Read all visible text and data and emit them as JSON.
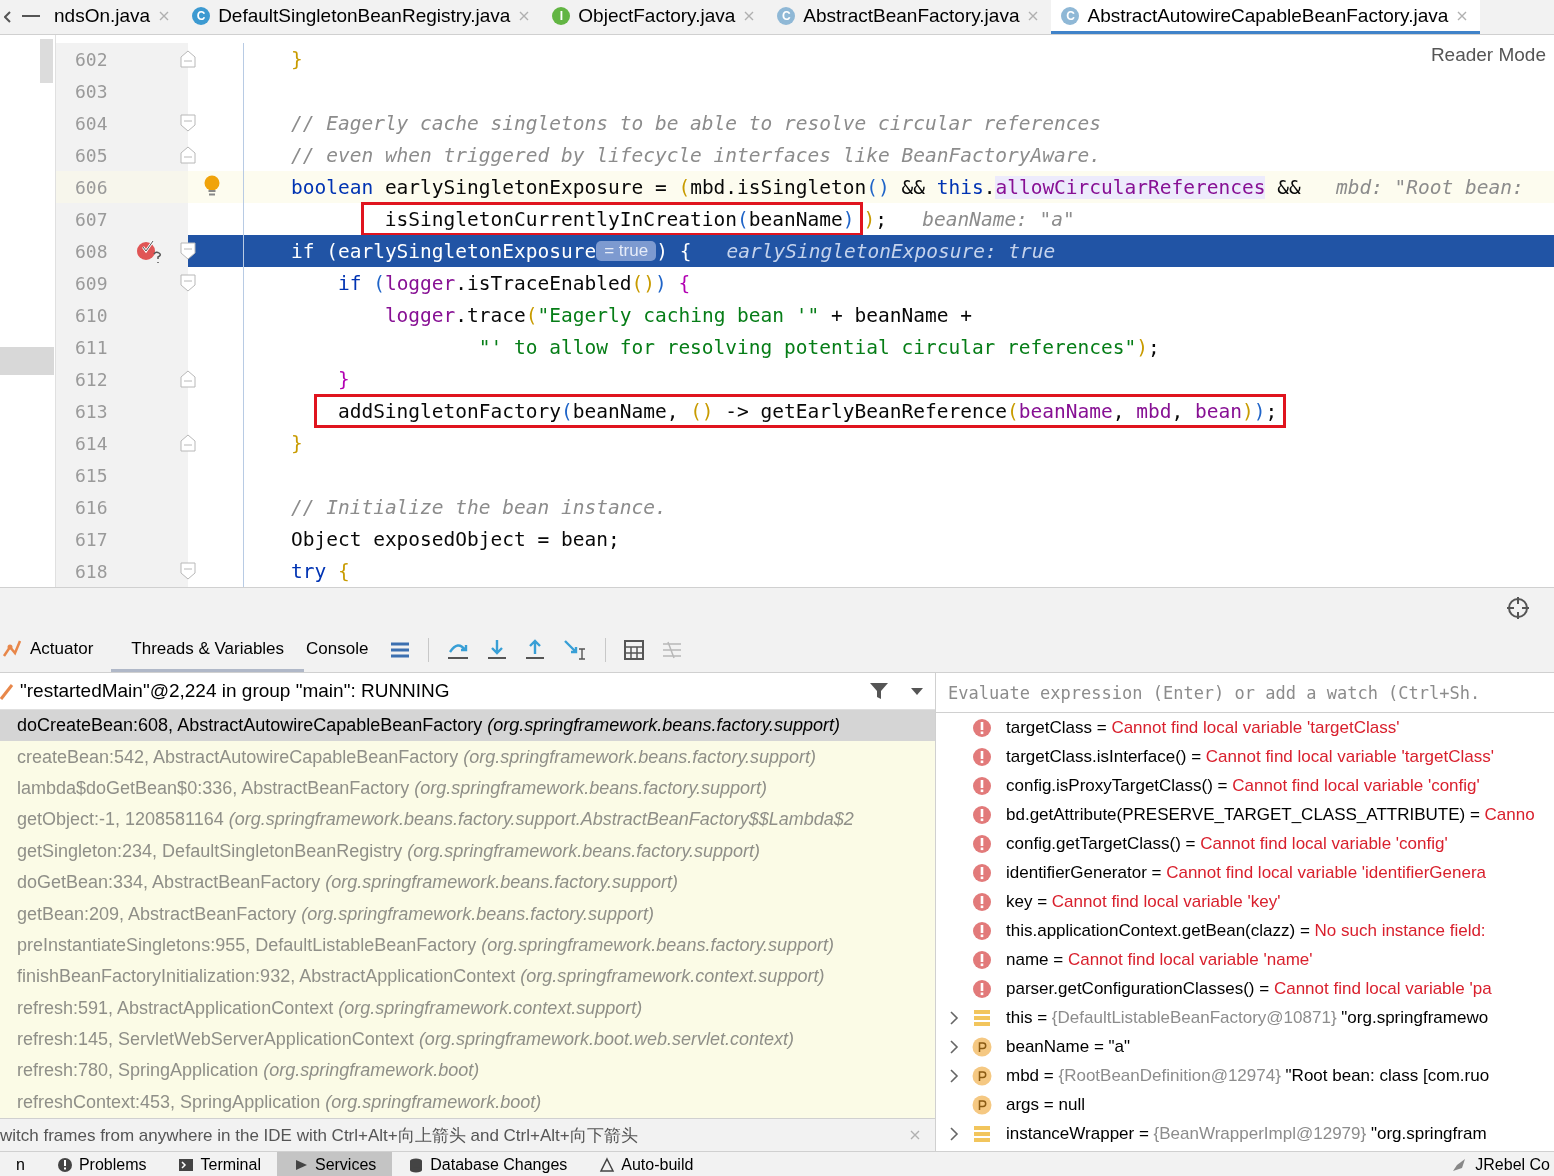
{
  "tabs": [
    {
      "label": "ndsOn.java",
      "selected": false
    },
    {
      "label": "DefaultSingletonBeanRegistry.java",
      "badge": "C",
      "kind": "class",
      "selected": false
    },
    {
      "label": "ObjectFactory.java",
      "badge": "I",
      "kind": "interface",
      "selected": false
    },
    {
      "label": "AbstractBeanFactory.java",
      "badge": "C",
      "kind": "abstract",
      "selected": false
    },
    {
      "label": "AbstractAutowireCapableBeanFactory.java",
      "badge": "C",
      "kind": "abstract",
      "selected": true
    }
  ],
  "editor": {
    "reader_mode": "Reader Mode",
    "lines": [
      {
        "number": "602",
        "fold_end": true,
        "segments": [
          {
            "text": "    }",
            "kind": "brace1"
          }
        ]
      },
      {
        "number": "603"
      },
      {
        "number": "604",
        "fold_start": true,
        "segments": [
          {
            "text": "    // Eagerly cache singletons to be able to resolve circular references",
            "kind": "comment"
          }
        ]
      },
      {
        "number": "605",
        "fold_end": true,
        "segments": [
          {
            "text": "    // even when triggered by lifecycle interfaces like BeanFactoryAware.",
            "kind": "comment"
          }
        ]
      },
      {
        "number": "606",
        "bulb": true,
        "caret_line": true,
        "segments": [
          {
            "text": "    boolean",
            "kind": "kw"
          },
          {
            "text": " earlySingletonExposure = ",
            "kind": "plain"
          },
          {
            "text": "(",
            "kind": "brace1"
          },
          {
            "text": "mbd.isSingleton",
            "kind": "plain"
          },
          {
            "text": "()",
            "kind": "brace2"
          },
          {
            "text": " && ",
            "kind": "plain"
          },
          {
            "text": "this",
            "kind": "kw"
          },
          {
            "text": ".",
            "kind": "plain"
          },
          {
            "text": "allowCircularReferences",
            "kind": "field_marked"
          },
          {
            "text": " &&   ",
            "kind": "plain"
          },
          {
            "text": "mbd: \"Root bean:",
            "kind": "hint"
          }
        ]
      },
      {
        "number": "607",
        "segments": [
          {
            "kind": "box",
            "segments": [
              {
                "text": "            isSingletonCurrentlyInCreation",
                "kind": "plain"
              },
              {
                "text": "(",
                "kind": "brace2"
              },
              {
                "text": "beanName",
                "kind": "plain"
              },
              {
                "text": ")",
                "kind": "brace2"
              }
            ]
          },
          {
            "text": ")",
            "kind": "brace1"
          },
          {
            "text": ";   ",
            "kind": "plain"
          },
          {
            "text": "beanName: \"a\"",
            "kind": "hint"
          }
        ]
      },
      {
        "number": "608",
        "breakpoint": true,
        "fold_start": true,
        "execution_point": true,
        "segments": [
          {
            "text": "    if (earlySingletonExposure",
            "kind": "plain"
          },
          {
            "text": "= true",
            "kind": "inline_value"
          },
          {
            "text": ") {   ",
            "kind": "plain"
          },
          {
            "text": "earlySingletonExposure: true",
            "kind": "hint"
          }
        ]
      },
      {
        "number": "609",
        "fold_start": true,
        "segments": [
          {
            "text": "        if ",
            "kind": "kw"
          },
          {
            "text": "(",
            "kind": "brace2"
          },
          {
            "text": "logger",
            "kind": "field"
          },
          {
            "text": ".isTraceEnabled",
            "kind": "plain"
          },
          {
            "text": "()",
            "kind": "brace1"
          },
          {
            "text": ") ",
            "kind": "brace2"
          },
          {
            "text": "{",
            "kind": "brace3"
          }
        ]
      },
      {
        "number": "610",
        "segments": [
          {
            "text": "            logger",
            "kind": "field"
          },
          {
            "text": ".trace",
            "kind": "plain"
          },
          {
            "text": "(",
            "kind": "brace1"
          },
          {
            "text": "\"Eagerly caching bean '\"",
            "kind": "str"
          },
          {
            "text": " + beanName +",
            "kind": "plain"
          }
        ]
      },
      {
        "number": "611",
        "segments": [
          {
            "text": "                    \"' to allow for resolving potential circular references\"",
            "kind": "str"
          },
          {
            "text": ")",
            "kind": "brace1"
          },
          {
            "text": ";",
            "kind": "plain"
          }
        ]
      },
      {
        "number": "612",
        "fold_end": true,
        "segments": [
          {
            "text": "        }",
            "kind": "brace3"
          }
        ]
      },
      {
        "number": "613",
        "segments": [
          {
            "kind": "box",
            "segments": [
              {
                "text": "        addSingletonFactory",
                "kind": "plain"
              },
              {
                "text": "(",
                "kind": "brace2"
              },
              {
                "text": "beanName, ",
                "kind": "plain"
              },
              {
                "text": "()",
                "kind": "brace1"
              },
              {
                "text": " -> getEarlyBeanReference",
                "kind": "plain"
              },
              {
                "text": "(",
                "kind": "brace1"
              },
              {
                "text": "beanName",
                "kind": "field"
              },
              {
                "text": ", ",
                "kind": "plain"
              },
              {
                "text": "mbd",
                "kind": "field"
              },
              {
                "text": ", ",
                "kind": "plain"
              },
              {
                "text": "bean",
                "kind": "field"
              },
              {
                "text": ")",
                "kind": "brace1"
              },
              {
                "text": ")",
                "kind": "brace2"
              },
              {
                "text": ";",
                "kind": "plain"
              }
            ]
          }
        ]
      },
      {
        "number": "614",
        "fold_end": true,
        "segments": [
          {
            "text": "    }",
            "kind": "brace1"
          }
        ]
      },
      {
        "number": "615"
      },
      {
        "number": "616",
        "segments": [
          {
            "text": "    // Initialize the bean instance.",
            "kind": "comment"
          }
        ]
      },
      {
        "number": "617",
        "segments": [
          {
            "text": "    Object exposedObject = bean;",
            "kind": "plain"
          }
        ]
      },
      {
        "number": "618",
        "fold_start": true,
        "segments": [
          {
            "text": "    try ",
            "kind": "kw"
          },
          {
            "text": "{",
            "kind": "brace1"
          }
        ]
      }
    ]
  },
  "debug_tabs": [
    {
      "label": "Actuator",
      "kind": "actuator",
      "selected": false
    },
    {
      "label": "Threads & Variables",
      "selected": true
    },
    {
      "label": "Console",
      "selected": false
    }
  ],
  "thread": {
    "label": "\"restartedMain\"@2,224 in group \"main\": RUNNING"
  },
  "frames": [
    {
      "method": "doCreateBean:608, AbstractAutowireCapableBeanFactory",
      "package": "(org.springframework.beans.factory.support)",
      "selected": true
    },
    {
      "method": "createBean:542, AbstractAutowireCapableBeanFactory",
      "package": "(org.springframework.beans.factory.support)",
      "selected": false
    },
    {
      "method": "lambda$doGetBean$0:336, AbstractBeanFactory",
      "package": "(org.springframework.beans.factory.support)",
      "selected": false
    },
    {
      "method": "getObject:-1, 1208581164",
      "package": "(org.springframework.beans.factory.support.AbstractBeanFactory$$Lambda$2",
      "selected": false
    },
    {
      "method": "getSingleton:234, DefaultSingletonBeanRegistry",
      "package": "(org.springframework.beans.factory.support)",
      "selected": false
    },
    {
      "method": "doGetBean:334, AbstractBeanFactory",
      "package": "(org.springframework.beans.factory.support)",
      "selected": false
    },
    {
      "method": "getBean:209, AbstractBeanFactory",
      "package": "(org.springframework.beans.factory.support)",
      "selected": false
    },
    {
      "method": "preInstantiateSingletons:955, DefaultListableBeanFactory",
      "package": "(org.springframework.beans.factory.support)",
      "selected": false
    },
    {
      "method": "finishBeanFactoryInitialization:932, AbstractApplicationContext",
      "package": "(org.springframework.context.support)",
      "selected": false
    },
    {
      "method": "refresh:591, AbstractApplicationContext",
      "package": "(org.springframework.context.support)",
      "selected": false
    },
    {
      "method": "refresh:145, ServletWebServerApplicationContext",
      "package": "(org.springframework.boot.web.servlet.context)",
      "selected": false
    },
    {
      "method": "refresh:780, SpringApplication",
      "package": "(org.springframework.boot)",
      "selected": false
    },
    {
      "method": "refreshContext:453, SpringApplication",
      "package": "(org.springframework.boot)",
      "selected": false
    }
  ],
  "frames_hint": "witch frames from anywhere in the IDE with Ctrl+Alt+向上箭头 and Ctrl+Alt+向下箭头",
  "evaluate": {
    "placeholder": "Evaluate expression (Enter) or add a watch (Ctrl+Sh."
  },
  "variables": [
    {
      "kind": "error",
      "name": "targetClass =",
      "message": "Cannot find local variable 'targetClass'"
    },
    {
      "kind": "error",
      "name": "targetClass.isInterface() =",
      "message": "Cannot find local variable 'targetClass'"
    },
    {
      "kind": "error",
      "name": "config.isProxyTargetClass() =",
      "message": "Cannot find local variable 'config'"
    },
    {
      "kind": "error",
      "name": "bd.getAttribute(PRESERVE_TARGET_CLASS_ATTRIBUTE) =",
      "message": "Canno"
    },
    {
      "kind": "error",
      "name": "config.getTargetClass() =",
      "message": "Cannot find local variable 'config'"
    },
    {
      "kind": "error",
      "name": "identifierGenerator =",
      "message": "Cannot find local variable 'identifierGenera"
    },
    {
      "kind": "error",
      "name": "key =",
      "message": "Cannot find local variable 'key'"
    },
    {
      "kind": "error",
      "name": "this.applicationContext.getBean(clazz) =",
      "message": "No such instance field:"
    },
    {
      "kind": "error",
      "name": "name =",
      "message": "Cannot find local variable 'name'"
    },
    {
      "kind": "error",
      "name": "parser.getConfigurationClasses() =",
      "message": "Cannot find local variable 'pa"
    },
    {
      "kind": "field",
      "name": "this =",
      "type": "{DefaultListableBeanFactory@10871}",
      "value": "\"org.springframewo",
      "expandable": true
    },
    {
      "kind": "param",
      "name": "beanName =",
      "value": "\"a\"",
      "expandable": true
    },
    {
      "kind": "param",
      "name": "mbd =",
      "type": "{RootBeanDefinition@12974}",
      "value": "\"Root bean: class [com.ruo",
      "expandable": true
    },
    {
      "kind": "param",
      "name": "args =",
      "value": "null",
      "expandable": false
    },
    {
      "kind": "field",
      "name": "instanceWrapper =",
      "type": "{BeanWrapperImpl@12979}",
      "value": "\"org.springfram",
      "expandable": true
    }
  ],
  "bottom_bar": [
    {
      "label": "n",
      "selected": false
    },
    {
      "label": "Problems",
      "kind": "problems",
      "selected": false
    },
    {
      "label": "Terminal",
      "kind": "terminal",
      "selected": false
    },
    {
      "label": "Services",
      "kind": "services",
      "selected": true
    },
    {
      "label": "Database Changes",
      "kind": "database",
      "selected": false
    },
    {
      "label": "Auto-build",
      "kind": "build",
      "selected": false
    }
  ],
  "bottom_right": {
    "label": "JRebel Co"
  }
}
